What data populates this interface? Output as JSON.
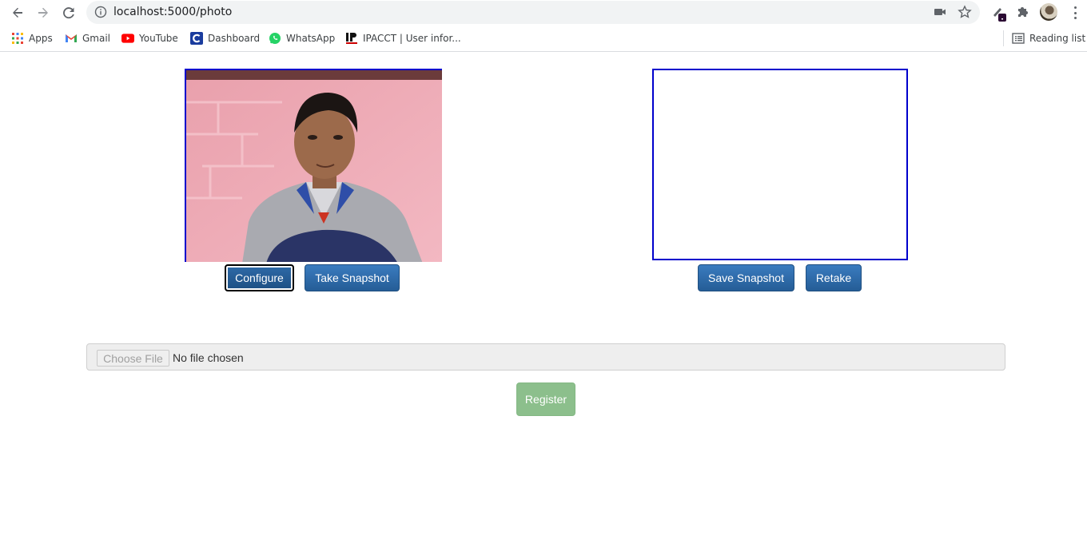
{
  "browser": {
    "url": "localhost:5000/photo",
    "reading_list_label": "Reading list",
    "bookmarks": [
      {
        "label": "Apps",
        "icon": "apps-grid-icon"
      },
      {
        "label": "Gmail",
        "icon": "gmail-icon"
      },
      {
        "label": "YouTube",
        "icon": "youtube-icon"
      },
      {
        "label": "Dashboard",
        "icon": "dashboard-icon"
      },
      {
        "label": "WhatsApp",
        "icon": "whatsapp-icon"
      },
      {
        "label": "IPACCT | User infor...",
        "icon": "ipacct-icon"
      }
    ]
  },
  "camera": {
    "configure_label": "Configure",
    "take_snapshot_label": "Take Snapshot"
  },
  "snapshot": {
    "save_label": "Save Snapshot",
    "retake_label": "Retake"
  },
  "file_input": {
    "button_label": "Choose File",
    "status": "No file chosen"
  },
  "register_label": "Register",
  "colors": {
    "frame_border": "#0000cc",
    "button_blue": "#2a6aa8",
    "register_green": "#8cbf8c"
  }
}
